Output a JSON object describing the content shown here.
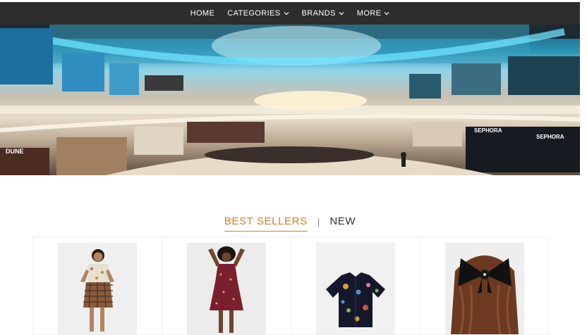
{
  "nav": {
    "items": [
      {
        "label": "HOME",
        "has_dropdown": false
      },
      {
        "label": "CATEGORIES",
        "has_dropdown": true
      },
      {
        "label": "BRANDS",
        "has_dropdown": true
      },
      {
        "label": "MORE",
        "has_dropdown": true
      }
    ]
  },
  "hero": {
    "signs": [
      "SEPHORA",
      "SEPHORA",
      "DUNE"
    ]
  },
  "tabs": {
    "best_sellers": "BEST SELLERS",
    "separator": "|",
    "new": "NEW"
  },
  "products": [
    {
      "image": "woman-floral-top-plaid-skirt"
    },
    {
      "image": "woman-red-floral-dress"
    },
    {
      "image": "black-floral-shirt"
    },
    {
      "image": "black-hair-bow"
    }
  ],
  "colors": {
    "nav_bg": "#2d2d2d",
    "accent": "#c9822f",
    "text_dark": "#333333"
  }
}
